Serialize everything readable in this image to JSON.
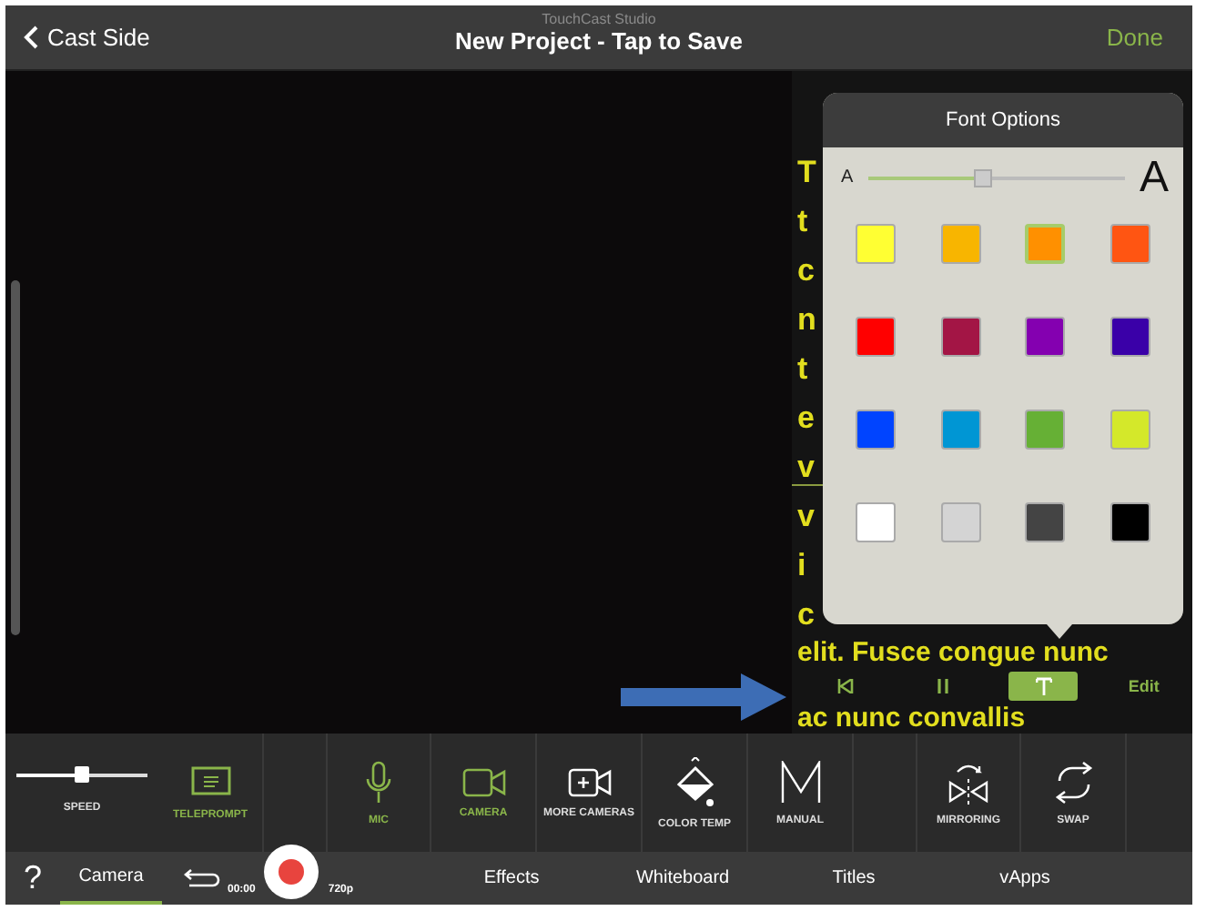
{
  "top_bar": {
    "back": "Cast Side",
    "subtitle": "TouchCast Studio",
    "title": "New Project - Tap to Save",
    "done": "Done"
  },
  "teleprompt": {
    "lines": [
      "T",
      "t",
      "c",
      "n",
      "t",
      "e",
      "v",
      "v",
      "i",
      "c"
    ],
    "tail_lines": [
      "elit. Fusce congue nunc",
      "ac nunc convallis"
    ],
    "controls": [
      {
        "kind": "rewind",
        "selected": false
      },
      {
        "kind": "pause",
        "selected": false
      },
      {
        "kind": "font",
        "selected": true
      },
      {
        "kind": "edit",
        "label": "Edit",
        "selected": false
      }
    ]
  },
  "font_options": {
    "title": "Font Options",
    "small": "A",
    "large": "A",
    "level": 0.45,
    "swatches": [
      {
        "color": "#ffff33",
        "selected": false
      },
      {
        "color": "#f8b500",
        "selected": false
      },
      {
        "color": "#ff9000",
        "selected": true
      },
      {
        "color": "#ff5512",
        "selected": false
      },
      {
        "color": "#ff0000",
        "selected": false
      },
      {
        "color": "#a31545",
        "selected": false
      },
      {
        "color": "#8400b0",
        "selected": false
      },
      {
        "color": "#3a00a8",
        "selected": false
      },
      {
        "color": "#0044ff",
        "selected": false
      },
      {
        "color": "#0096d4",
        "selected": false
      },
      {
        "color": "#66b035",
        "selected": false
      },
      {
        "color": "#d4e82a",
        "selected": false
      },
      {
        "color": "#ffffff",
        "selected": false
      },
      {
        "color": "#d4d4d4",
        "selected": false
      },
      {
        "color": "#444444",
        "selected": false
      },
      {
        "color": "#000000",
        "selected": false
      }
    ]
  },
  "toolbar": [
    {
      "kind": "speed",
      "label": "SPEED",
      "level": 0.5,
      "on": false
    },
    {
      "kind": "teleprompt",
      "label": "TELEPROMPT",
      "on": true
    },
    {
      "kind": "mic",
      "label": "MIC",
      "on": true,
      "gap_before": true
    },
    {
      "kind": "camera",
      "label": "CAMERA",
      "on": true
    },
    {
      "kind": "more_cameras",
      "label": "MORE CAMERAS",
      "on": false
    },
    {
      "kind": "color_temp",
      "label": "COLOR TEMP",
      "on": false
    },
    {
      "kind": "manual",
      "label": "MANUAL",
      "on": false
    },
    {
      "kind": "mirroring",
      "label": "MIRRORING",
      "on": false,
      "gap_before": true
    },
    {
      "kind": "swap",
      "label": "SWAP",
      "on": false
    }
  ],
  "bottom_bar": {
    "help": "?",
    "time": "00:00",
    "resolution": "720p",
    "tabs": [
      {
        "label": "Camera",
        "selected": true
      },
      {
        "label": "Effects",
        "selected": false
      },
      {
        "label": "Whiteboard",
        "selected": false
      },
      {
        "label": "Titles",
        "selected": false
      },
      {
        "label": "vApps",
        "selected": false
      }
    ]
  }
}
